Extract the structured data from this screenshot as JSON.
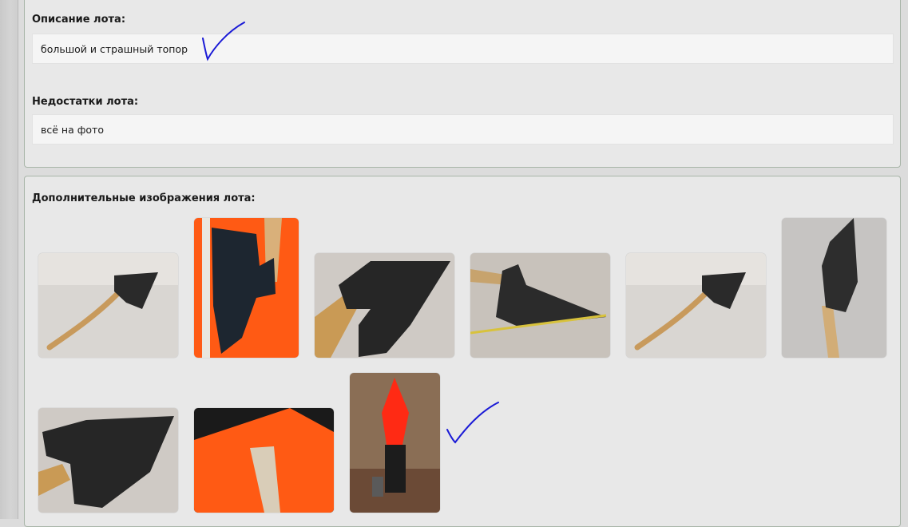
{
  "lot": {
    "description_label": "Описание лота:",
    "description_value": "большой и страшный топор",
    "defects_label": "Недостатки лота:",
    "defects_value": "всё на фото"
  },
  "images_section": {
    "label": "Дополнительные изображения лота:",
    "thumbnails": [
      "axe-with-curved-handle-photo",
      "axe-head-on-orange-cloth-with-ruler-photo",
      "axe-head-closeup-photo",
      "axe-with-measuring-tape-photo",
      "axe-with-curved-handle-photo-2",
      "axe-standing-upright-photo",
      "axe-head-closeup-photo-2",
      "axe-handle-on-orange-cloth-photo",
      "executioner-figure-with-red-hood-photo"
    ]
  },
  "annotation_color": "#1a1ad6"
}
